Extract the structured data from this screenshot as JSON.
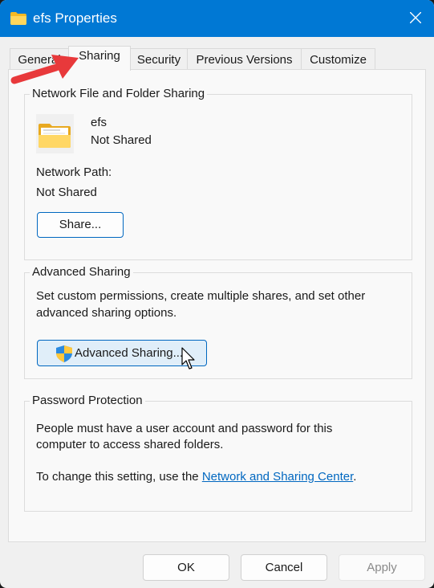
{
  "window": {
    "title": "efs Properties",
    "title_icon": "folder-icon",
    "close_icon": "close-icon"
  },
  "tabs": [
    {
      "label": "General",
      "active": false
    },
    {
      "label": "Sharing",
      "active": true
    },
    {
      "label": "Security",
      "active": false
    },
    {
      "label": "Previous Versions",
      "active": false
    },
    {
      "label": "Customize",
      "active": false
    }
  ],
  "network_sharing": {
    "title": "Network File and Folder Sharing",
    "folder_name": "efs",
    "folder_status": "Not Shared",
    "network_path_label": "Network Path:",
    "network_path_value": "Not Shared",
    "share_button": "Share..."
  },
  "advanced_sharing": {
    "title": "Advanced Sharing",
    "description_line1": "Set custom permissions, create multiple shares, and set other",
    "description_line2": "advanced sharing options.",
    "button_label": "Advanced Sharing...",
    "button_icon": "uac-shield-icon"
  },
  "password_protection": {
    "title": "Password Protection",
    "description_line1": "People must have a user account and password for this",
    "description_line2": "computer to access shared folders.",
    "change_prefix": "To change this setting, use the ",
    "link_text": "Network and Sharing Center",
    "change_suffix": "."
  },
  "footer": {
    "ok": "OK",
    "cancel": "Cancel",
    "apply": "Apply"
  },
  "annotations": {
    "arrow_color": "#e8393b"
  },
  "colors": {
    "titlebar": "#0078d4",
    "link": "#0067c0"
  }
}
